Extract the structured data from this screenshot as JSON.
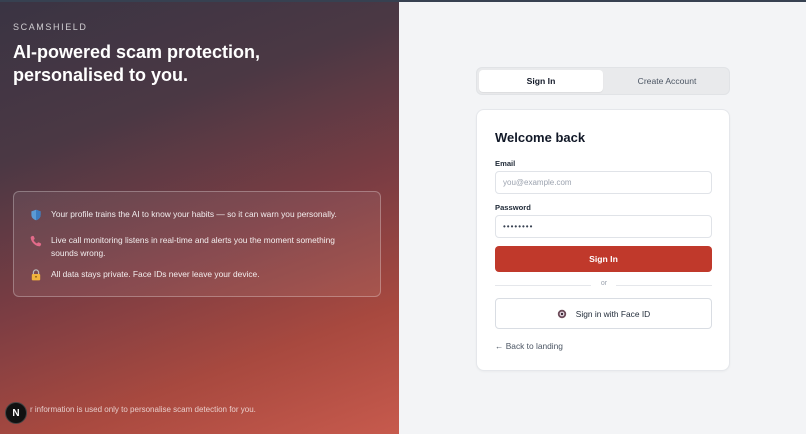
{
  "brand": {
    "name": "SCAMSHIELD",
    "headline": "AI-powered scam protection, personalised to you."
  },
  "features": [
    {
      "icon": "shield-icon",
      "text": "Your profile trains the AI to know your habits — so it can warn you personally."
    },
    {
      "icon": "phone-icon",
      "text": "Live call monitoring listens in real-time and alerts you the moment something sounds wrong."
    },
    {
      "icon": "lock-icon",
      "text": "All data stays private. Face IDs never leave your device."
    }
  ],
  "disclaimer": "r information is used only to personalise scam detection for you.",
  "badge": "N",
  "tabs": [
    {
      "label": "Sign In",
      "active": true
    },
    {
      "label": "Create Account",
      "active": false
    }
  ],
  "form": {
    "title": "Welcome back",
    "email_label": "Email",
    "email_placeholder": "you@example.com",
    "password_label": "Password",
    "password_value": "••••••••",
    "submit_label": "Sign In",
    "divider_text": "or",
    "face_id_label": "Sign in with Face ID",
    "back_link": "← Back to landing"
  },
  "colors": {
    "accent": "#c0392b",
    "shield": "#5b9bd5",
    "phone": "#e26b8a",
    "lock": "#f2b33d"
  }
}
